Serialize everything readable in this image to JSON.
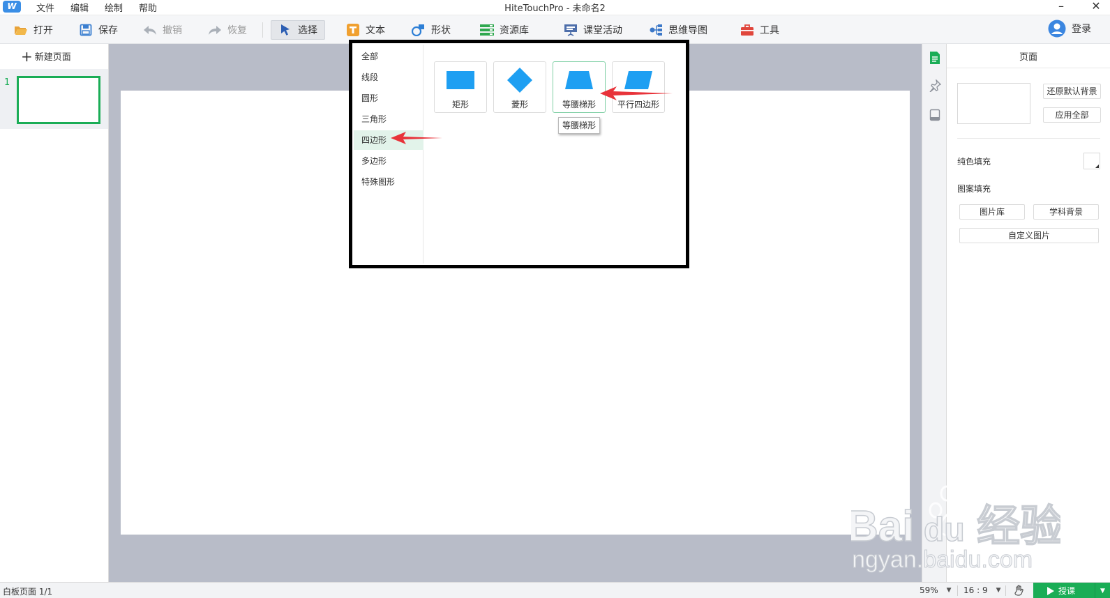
{
  "titlebar": {
    "app_logo": "W",
    "menu": [
      "文件",
      "编辑",
      "绘制",
      "帮助"
    ],
    "title": "HiteTouchPro - 未命名2",
    "minimize": "–",
    "close": "✕"
  },
  "toolbar": {
    "open": "打开",
    "save": "保存",
    "undo": "撤销",
    "redo": "恢复",
    "select": "选择",
    "text": "文本",
    "shape": "形状",
    "resources": "资源库",
    "classroom": "课堂活动",
    "mindmap": "思维导图",
    "tools": "工具",
    "login": "登录"
  },
  "left_panel": {
    "new_page": "新建页面",
    "page_number": "1"
  },
  "shape_popup": {
    "categories": [
      "全部",
      "线段",
      "圆形",
      "三角形",
      "四边形",
      "多边形",
      "特殊图形"
    ],
    "selected_category": "四边形",
    "shapes": [
      "矩形",
      "菱形",
      "等腰梯形",
      "平行四边形"
    ],
    "hovered_shape": "等腰梯形",
    "tooltip": "等腰梯形",
    "shape_color": "#1e9ff2"
  },
  "right_panel": {
    "title": "页面",
    "restore_bg": "还原默认背景",
    "apply_all": "应用全部",
    "solid_fill": "纯色填充",
    "pattern_fill": "图案填充",
    "gallery": "图片库",
    "subject_bg": "学科背景",
    "custom_image": "自定义图片"
  },
  "statusbar": {
    "page_info": "白板页面 1/1",
    "zoom": "59%",
    "ratio": "16 : 9",
    "lecture": "授课"
  },
  "colors": {
    "accent_green": "#1aad56",
    "annotation_red": "#e8333a"
  },
  "watermark": {
    "line1": "Bai",
    "line1b": "du",
    "line1c": "经验",
    "line2": "jingyan.baidu.com"
  }
}
